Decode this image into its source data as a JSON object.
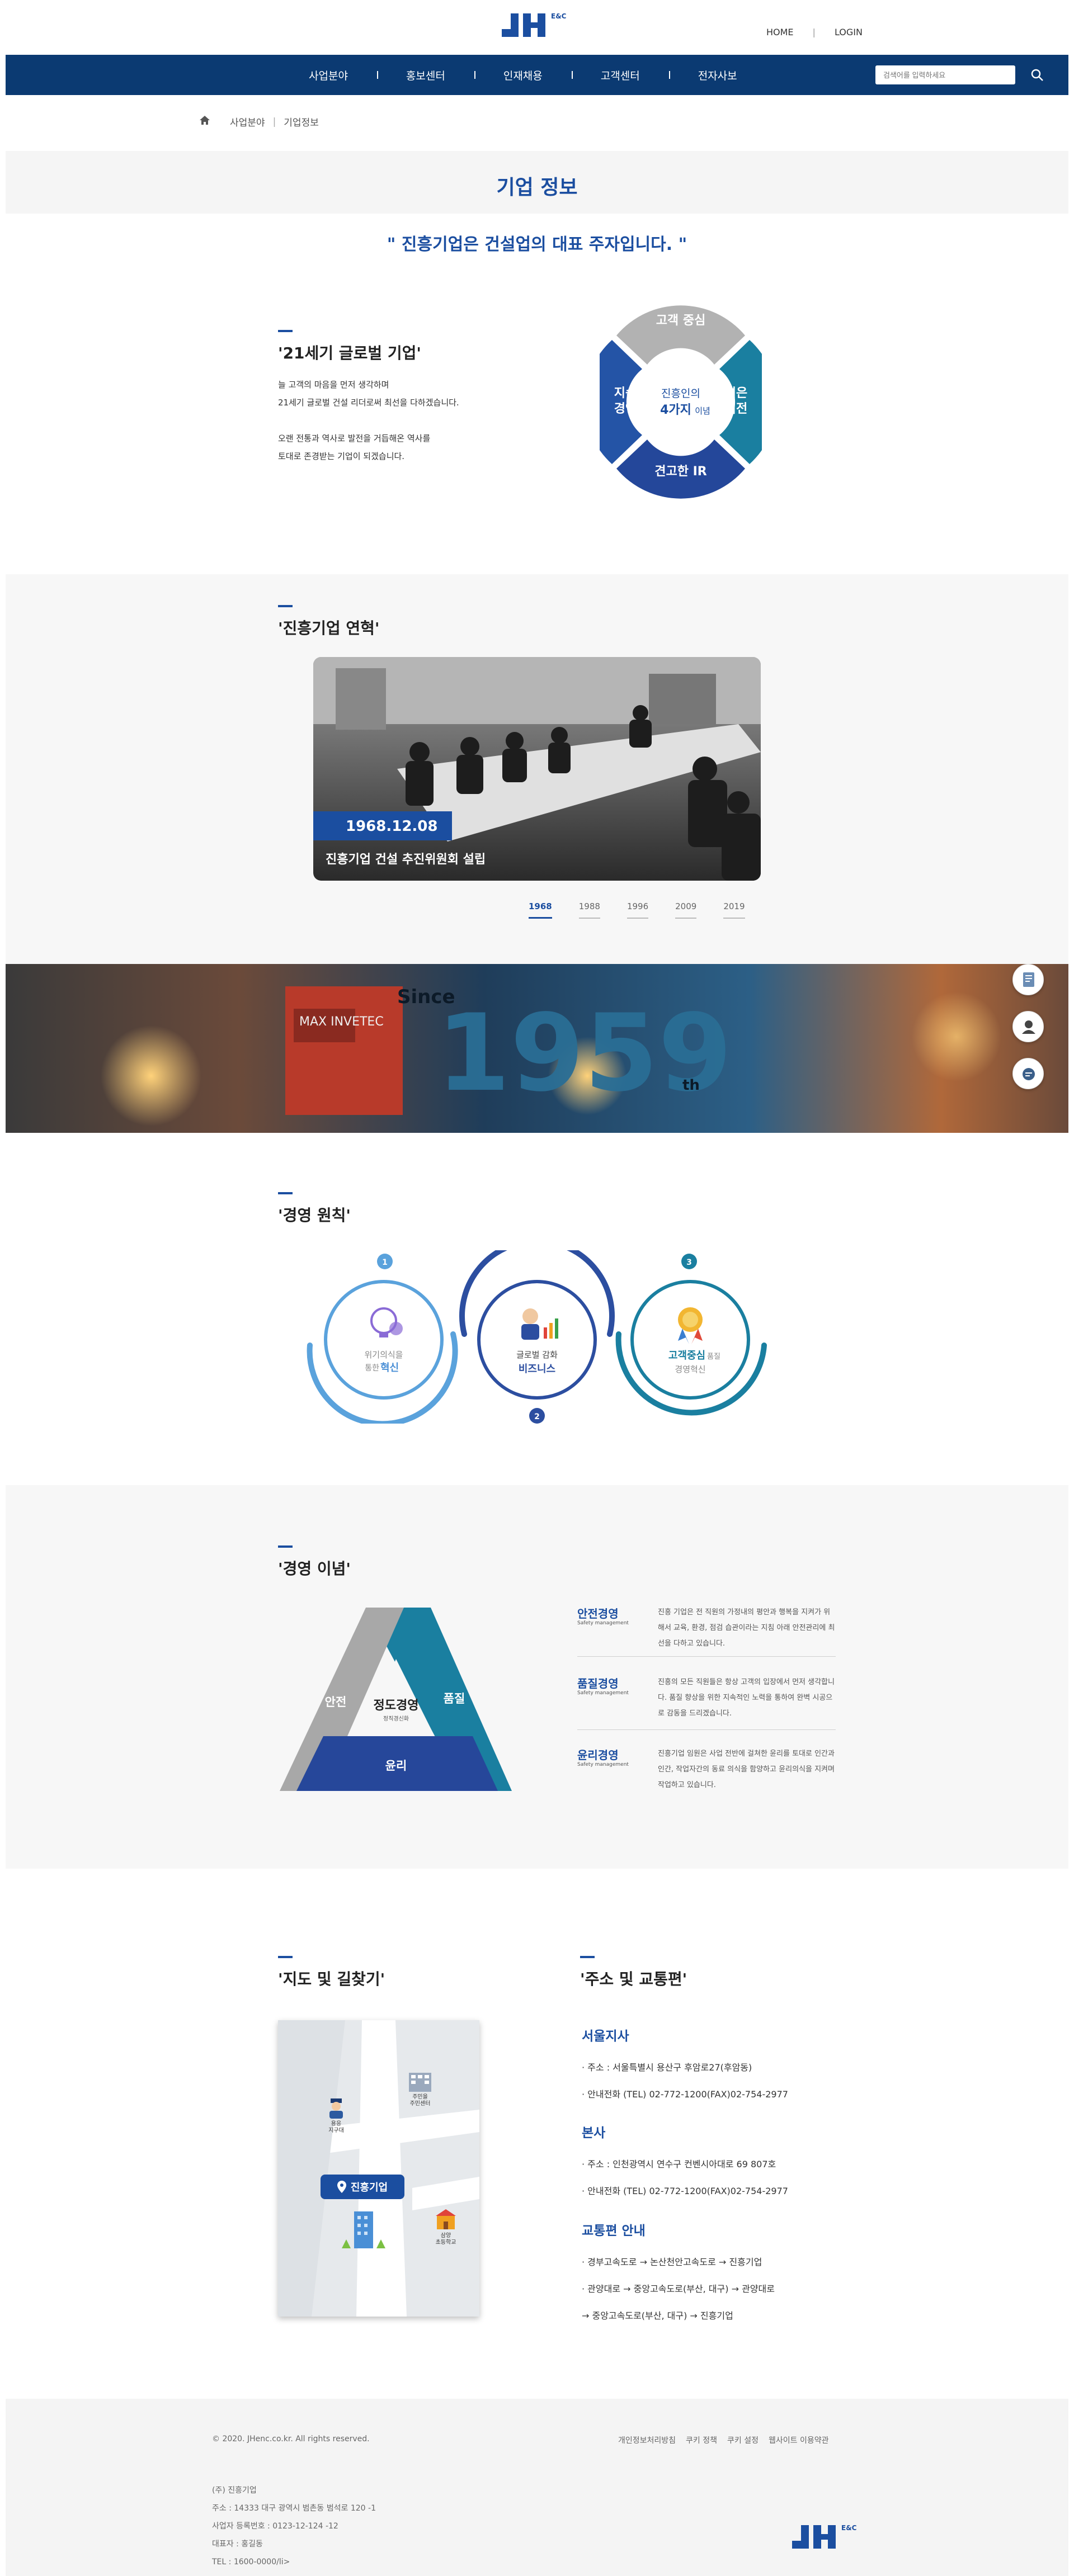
{
  "header": {
    "logo_text": "JH",
    "logo_sub": "E&C",
    "top_links": [
      "HOME",
      "LOGIN"
    ]
  },
  "nav": {
    "items": [
      "사업분야",
      "홍보센터",
      "인재채용",
      "고객센터",
      "전자사보"
    ],
    "search_placeholder": "검색어를 입력하세요"
  },
  "breadcrumb": [
    "사업분야",
    "기업정보"
  ],
  "page_title": "기업 정보",
  "slogan": "\" 진흥기업은 건설업의 대표 주자입니다. \"",
  "intro": {
    "title": "'21세기 글로벌 기업'",
    "lines": [
      "늘 고객의 마음을 먼저 생각하며",
      "21세기 글로벌 건설 리더로써 최선을 다하겠습니다.",
      "",
      "오랜 전통과 역사로 발전을 거듭해온 역사를",
      "토대로 존경받는 기업이 되겠습니다."
    ]
  },
  "values_wheel": {
    "top": "고객 중심",
    "left": [
      "지속",
      "경영"
    ],
    "right": [
      "넓은",
      "비전"
    ],
    "bottom": "견고한 IR",
    "center_line1": "진흥인의",
    "center_bold": "4가지",
    "center_small": "이념"
  },
  "history": {
    "title": "'진흥기업 연혁'",
    "date": "1968.12.08",
    "caption": "진흥기업 건설 추진위원회 설립",
    "years": [
      "1968",
      "1988",
      "1996",
      "2009",
      "2019"
    ],
    "active_year": "1968"
  },
  "banner": {
    "since": "Since",
    "year": "1959",
    "suffix": "th",
    "machine_label": "MAX INVETEC"
  },
  "principles": {
    "title": "'경영 원칙'",
    "items": [
      {
        "num": "1",
        "line1": "위기의식을",
        "line2_pre": "통한 ",
        "line2_bold": "혁신"
      },
      {
        "num": "2",
        "line1": "글로벌 감화",
        "line2_pre": "",
        "line2_bold": "비즈니스"
      },
      {
        "num": "3",
        "line1": "고객중심",
        "line1_small": "품질",
        "line2_pre": "경영혁신",
        "line2_bold": ""
      }
    ]
  },
  "philosophy": {
    "title": "'경영 이념'",
    "triangle": {
      "left": "안전",
      "right": "품질",
      "bottom": "윤리",
      "center": "정도경영",
      "center_sub": "정직경신화"
    },
    "rows": [
      {
        "head": "안전경영",
        "sub": "Safety management",
        "body": "진흥 기업은 전 직원의 가정내의 평안과 행복을 지켜가 위해서 교육, 환경, 점검 습관이라는 지침 아래 안전관리에 최선을 다하고 있습니다."
      },
      {
        "head": "품질경영",
        "sub": "Safety management",
        "body": "진흥의 모든 직원들은 항상 고객의 입장에서 먼저 생각합니다. 품질 향상을 위한 지속적인 노력을 통하여 완벽 시공으로 감동을 드리겠습니다."
      },
      {
        "head": "윤리경영",
        "sub": "Safety management",
        "body": "진흥기업 임원은 사업 전반에 걸쳐한 윤리를 토대로 인간과 인간, 작업자간의 동료 의식을 함양하고 윤리의식을 지켜며 작업하고 있습니다."
      }
    ]
  },
  "location": {
    "map_title": "'지도 및 길찾기'",
    "addr_title": "'주소 및 교통편'",
    "map_labels": {
      "pin": "진흥기업",
      "police": [
        "용응",
        "지구대"
      ],
      "center": [
        "주민을",
        "주민센터"
      ],
      "school": [
        "삼양",
        "초등학교"
      ]
    },
    "seoul": {
      "head": "서울지사",
      "address": "· 주소 : 서울특별시 용산구 후암로27(후암동)",
      "phone": "· 안내전화 (TEL) 02-772-1200(FAX)02-754-2977"
    },
    "hq": {
      "head": "본사",
      "address": "· 주소 : 인천광역시 연수구 컨벤시아대로 69 807호",
      "phone": "· 안내전화 (TEL) 02-772-1200(FAX)02-754-2977"
    },
    "transit": {
      "head": "교통편 안내",
      "lines": [
        "· 경부고속도로 → 논산천안고속도로 → 진흥기업",
        "· 관양대로 → 중앙고속도로(부산, 대구) → 관양대로",
        "→ 중앙고속도로(부산, 대구) → 진흥기업"
      ]
    }
  },
  "footer": {
    "copyright": "© 2020. JHenc.co.kr. All rights reserved.",
    "links": [
      "개인정보처리방침",
      "쿠키 정책",
      "쿠키 설정",
      "웹사이트 이용약관"
    ],
    "info": [
      "(주) 진흥기업",
      "주소 : 14333 대구 광역시 범촌동 범석로 120 -1",
      "사업자 등록번호 : 0123-12-124 -12",
      "대표자 : 홍길동",
      "TEL : 1600-0000/li>"
    ]
  },
  "colors": {
    "navy": "#0b3a72",
    "blue": "#1b4ea0",
    "teal": "#1a7fa0",
    "gray": "#b0b0b0"
  }
}
